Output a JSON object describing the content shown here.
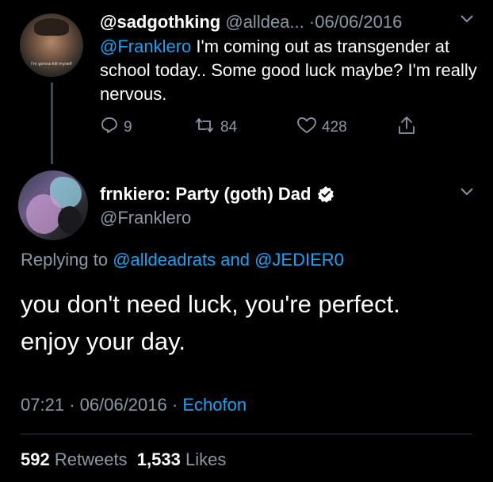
{
  "tweet1": {
    "display_name": "@sadgothking",
    "handle": "@alldea...",
    "separator": "·",
    "date": "06/06/2016",
    "mention": "@Franklero",
    "text": " I'm coming out as transgender at school today.. Some good luck maybe? I'm really nervous.",
    "avatar_caption": "I'm gonna kill myself",
    "actions": {
      "reply_count": "9",
      "retweet_count": "84",
      "like_count": "428"
    }
  },
  "tweet2": {
    "display_name": "frnkiero: Party (goth) Dad",
    "handle": "@Franklero",
    "replying_prefix": "Replying to ",
    "replying_user1": "@alldeadrats",
    "replying_and": " and ",
    "replying_user2": "@JEDIER0",
    "text_line1": "you don't need luck, you're perfect.",
    "text_line2": "enjoy your day.",
    "time": "07:21",
    "separator": "·",
    "date": "06/06/2016",
    "separator2": "·",
    "source": "Echofon",
    "retweets_count": "592",
    "retweets_label": "Retweets",
    "likes_count": "1,533",
    "likes_label": "Likes"
  },
  "colors": {
    "background": "#000000",
    "muted": "#8899a6",
    "link": "#1da1f2",
    "verified": "#ffffff",
    "thread_line": "#3f4952"
  },
  "icons": [
    "chevron-down-icon",
    "reply-icon",
    "retweet-icon",
    "like-icon",
    "share-icon",
    "verified-icon"
  ]
}
